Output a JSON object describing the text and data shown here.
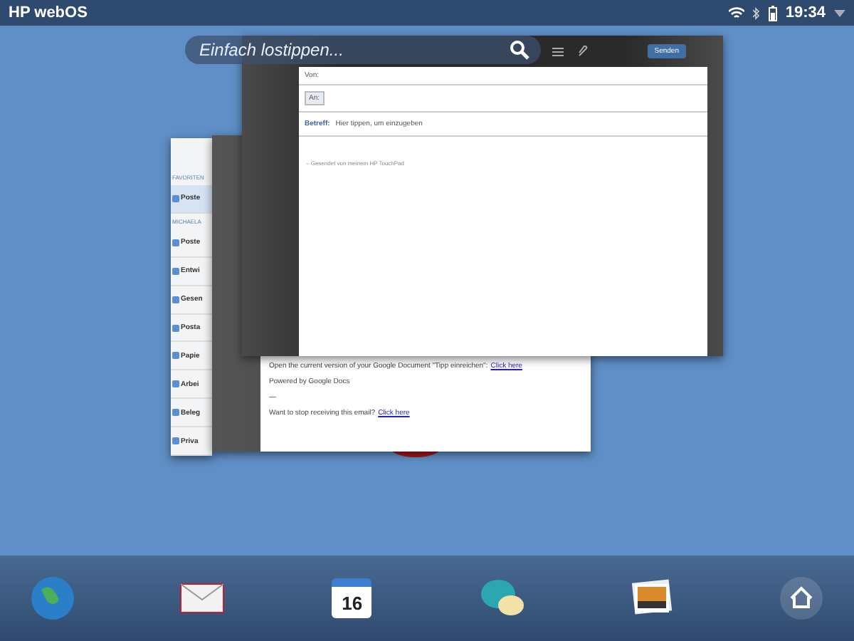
{
  "status_bar": {
    "title": "HP webOS",
    "time": "19:34"
  },
  "search": {
    "placeholder": "Einfach lostippen..."
  },
  "folder_card": {
    "section_1": "FAVORITEN",
    "favorites": [
      {
        "label": "Poste",
        "selected": true
      }
    ],
    "section_2": "MICHAELA",
    "folders": [
      {
        "label": "Poste"
      },
      {
        "label": "Entwi"
      },
      {
        "label": "Gesen"
      },
      {
        "label": "Posta"
      },
      {
        "label": "Papie"
      },
      {
        "label": "Arbei"
      },
      {
        "label": "Beleg"
      },
      {
        "label": "Priva"
      }
    ]
  },
  "message_card": {
    "lines": [
      {
        "text": "Open the current version of your Google Document \"Tipp einreichen\":",
        "link": "Click here"
      },
      {
        "text": "Powered by Google Docs"
      },
      {
        "text": "—"
      },
      {
        "text": "Want to stop receiving this email?",
        "link": "Click here"
      }
    ]
  },
  "compose_card": {
    "send": "Senden",
    "from_label": "Von:",
    "to_label": "An:",
    "subject_label": "Betreff:",
    "subject_placeholder": "Hier tippen, um einzugeben",
    "signature": "– Gesendet von meinem HP TouchPad"
  },
  "dock": {
    "calendar_day": "16"
  }
}
